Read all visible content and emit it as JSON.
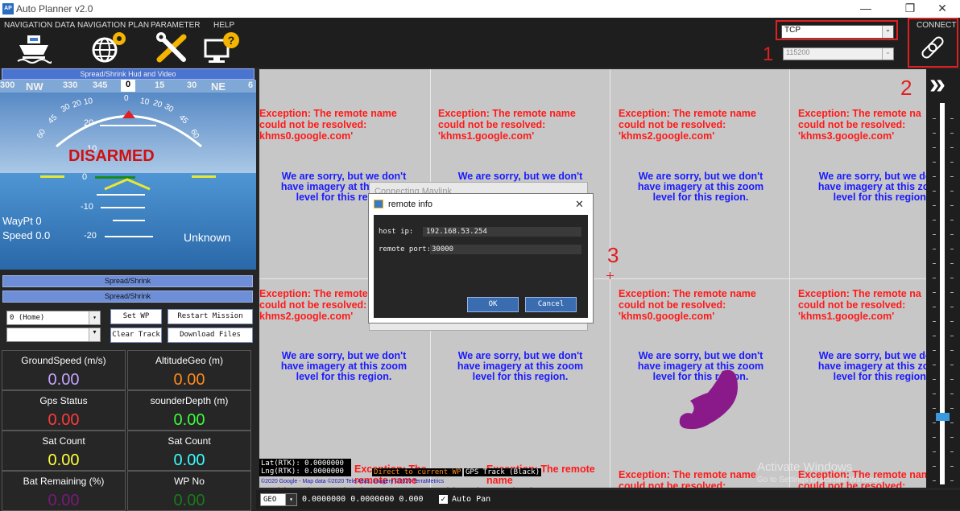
{
  "window": {
    "title": "Auto Planner v2.0",
    "minimize": "—",
    "restore": "❐",
    "close": "✕",
    "app_icon_text": "AP"
  },
  "menu": {
    "navigation_data": "NAVIGATION DATA",
    "navigation_plan": "NAVIGATION PLAN",
    "parameter": "PARAMETER",
    "help": "HELP",
    "connect": "CONNECT"
  },
  "connection": {
    "protocol": "TCP",
    "baud": "115200"
  },
  "annotations": {
    "one": "1",
    "two": "2",
    "three": "3"
  },
  "hud": {
    "toggle_label": "Spread/Shrink Hud and Video",
    "compass": [
      "300",
      "NW",
      "330",
      "345",
      "0",
      "15",
      "30",
      "NE",
      "6"
    ],
    "armed_state": "DISARMED",
    "waypoint": "WayPt 0",
    "speed": "Speed 0.0",
    "mode": "Unknown",
    "pitch_zero": "0",
    "pitch_neg10": "-10",
    "pitch_neg20": "-20",
    "pitch_pos20": "20",
    "pitch_pos10": "10",
    "roll_ticks": [
      "30",
      "20",
      "10",
      "0",
      "10",
      "20",
      "30",
      "45",
      "60",
      "45",
      "60"
    ]
  },
  "controls": {
    "spread_shrink_1": "Spread/Shrink",
    "spread_shrink_2": "Spread/Shrink",
    "wp_select": "0 (Home)",
    "set_wp": "Set WP",
    "restart_mission": "Restart Mission",
    "clear_track": "Clear Track",
    "download_files": "Download Files"
  },
  "stats": [
    {
      "label": "GroundSpeed (m/s)",
      "value": "0.00",
      "color": "#c6a4ff"
    },
    {
      "label": "AltitudeGeo (m)",
      "value": "0.00",
      "color": "#ff8c1a"
    },
    {
      "label": "Gps Status",
      "value": "0.00",
      "color": "#ff3b3b"
    },
    {
      "label": "sounderDepth (m)",
      "value": "0.00",
      "color": "#3bff3b"
    },
    {
      "label": "Sat Count",
      "value": "0.00",
      "color": "#ffff3b"
    },
    {
      "label": "Sat Count",
      "value": "0.00",
      "color": "#3bffff"
    },
    {
      "label": "Bat Remaining (%)",
      "value": "0.00",
      "color": "#7a1a7a"
    },
    {
      "label": "WP No",
      "value": "0.00",
      "color": "#1a7a1a"
    }
  ],
  "map": {
    "exceptions": [
      [
        "Exception: The remote name",
        "could not be resolved:",
        "khms0.google.com'"
      ],
      [
        "Exception: The remote name",
        "could not be resolved:",
        "'khms1.google.com'"
      ],
      [
        "Exception: The remote name",
        "could not be resolved:",
        "'khms2.google.com'"
      ],
      [
        "Exception: The remote na",
        "could not be resolved:",
        "'khms3.google.com'"
      ],
      [
        "Exception: The remote",
        "could not be resolved:",
        "khms2.google.com'"
      ],
      [
        "Exception: The remote name",
        "could not be resolved:",
        "'khms0.google.com'"
      ],
      [
        "Exception: The remote na",
        "could not be resolved:",
        "'khms1.google.com'"
      ]
    ],
    "sorry": [
      "We are sorry, but we don't",
      "have imagery at this zoom",
      "level for this region."
    ],
    "bottom_exc_a": "Exception: The remote name",
    "bottom_exc_b": "could not be resolved:",
    "lat": "Lat(RTK): 0.0000000",
    "lng": "Lng(RTK): 0.0000000",
    "direct_label": "Direct to current WP",
    "gps_track": "GPS Track (Black)",
    "copyright": "©2020 Google - Map data ©2020 Tele Atlas, Imagery ©2020 TerraMetrics",
    "activate_title": "Activate Windows",
    "activate_sub": "Go to Settings to activate Windows."
  },
  "bottombar": {
    "coord_type": "GEO",
    "coords": "0.0000000 0.0000000 0.000",
    "auto_pan": "Auto Pan"
  },
  "dialog_back": {
    "title": "Connecting Mavlink"
  },
  "dialog": {
    "title": "remote info",
    "host_label": "host ip:",
    "host_value": "192.168.53.254",
    "port_label": "remote port:",
    "port_value": "30000",
    "ok": "OK",
    "cancel": "Cancel",
    "close": "✕"
  },
  "slider": {
    "chevron": "»",
    "level": 0.17
  }
}
